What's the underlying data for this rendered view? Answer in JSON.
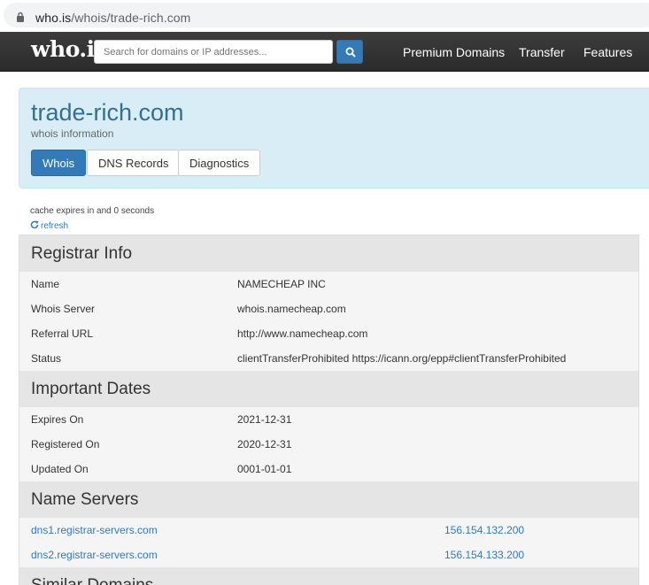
{
  "browser": {
    "url_host": "who.is",
    "url_path": "/whois/trade-rich.com"
  },
  "navbar": {
    "logo": "who.is",
    "search_placeholder": "Search for domains or IP addresses...",
    "links": [
      "Premium Domains",
      "Transfer",
      "Features"
    ]
  },
  "header": {
    "domain": "trade-rich.com",
    "subtitle": "whois information",
    "tabs": [
      "Whois",
      "DNS Records",
      "Diagnostics"
    ],
    "active_tab": "Whois"
  },
  "cache": {
    "text": "cache expires in and 0 seconds",
    "refresh": "refresh"
  },
  "registrar": {
    "title": "Registrar Info",
    "rows": [
      {
        "label": "Name",
        "value": "NAMECHEAP INC"
      },
      {
        "label": "Whois Server",
        "value": "whois.namecheap.com"
      },
      {
        "label": "Referral URL",
        "value": "http://www.namecheap.com"
      },
      {
        "label": "Status",
        "value": "clientTransferProhibited https://icann.org/epp#clientTransferProhibited"
      }
    ]
  },
  "dates": {
    "title": "Important Dates",
    "rows": [
      {
        "label": "Expires On",
        "value": "2021-12-31"
      },
      {
        "label": "Registered On",
        "value": "2020-12-31"
      },
      {
        "label": "Updated On",
        "value": "0001-01-01"
      }
    ]
  },
  "nameservers": {
    "title": "Name Servers",
    "rows": [
      {
        "name": "dns1.registrar-servers.com",
        "ip": "156.154.132.200"
      },
      {
        "name": "dns2.registrar-servers.com",
        "ip": "156.154.133.200"
      }
    ]
  },
  "similar": {
    "title": "Similar Domains"
  },
  "colors": {
    "primary": "#337ab7",
    "jumbotron": "#d9edf7",
    "title": "#31708f"
  }
}
